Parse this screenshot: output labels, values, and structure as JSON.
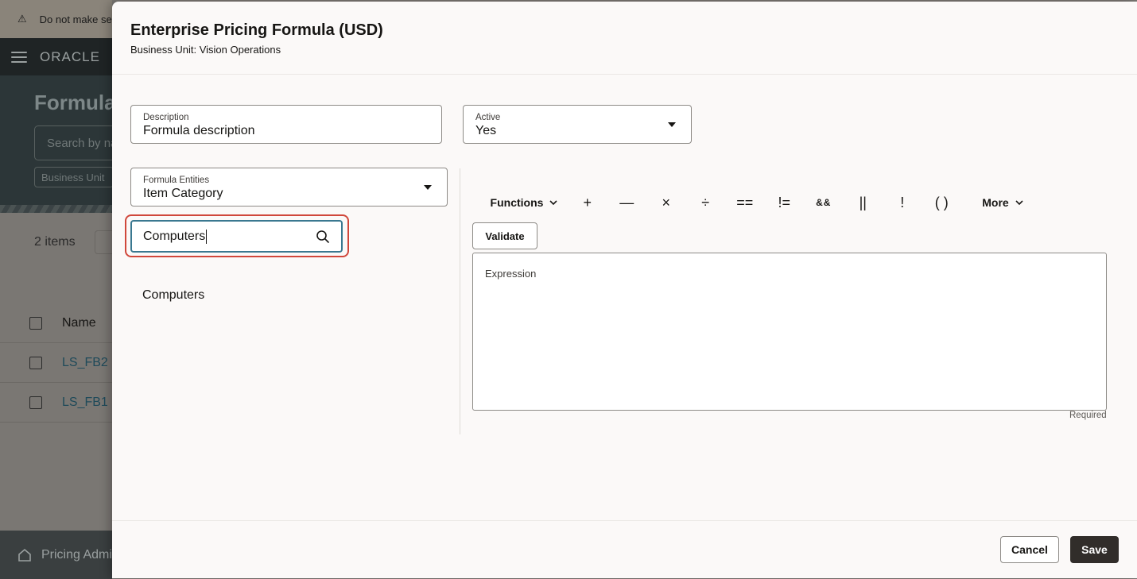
{
  "background": {
    "warning_text": "Do not make se",
    "logo": "ORACLE",
    "page_title": "Formula",
    "search_placeholder": "Search by na",
    "filter_chip": "Business Unit",
    "items_count": "2 items",
    "table": {
      "name_header": "Name",
      "rows": [
        {
          "name": "LS_FB2"
        },
        {
          "name": "LS_FB1"
        }
      ]
    },
    "footer_nav": "Pricing Admi"
  },
  "drawer": {
    "title": "Enterprise Pricing Formula (USD)",
    "subtitle": "Business Unit: Vision Operations",
    "description": {
      "label": "Description",
      "value": "Formula description"
    },
    "active": {
      "label": "Active",
      "value": "Yes"
    },
    "formula_entities": {
      "label": "Formula Entities",
      "value": "Item Category"
    },
    "search": {
      "value": "Computers"
    },
    "results": [
      "Computers"
    ],
    "toolbar": {
      "functions_label": "Functions",
      "operators": [
        "+",
        "—",
        "×",
        "÷",
        "==",
        "!=",
        "&&",
        "||",
        "!",
        "( )"
      ],
      "more_label": "More"
    },
    "validate_label": "Validate",
    "expression_label": "Expression",
    "required_label": "Required",
    "cancel_label": "Cancel",
    "save_label": "Save"
  }
}
